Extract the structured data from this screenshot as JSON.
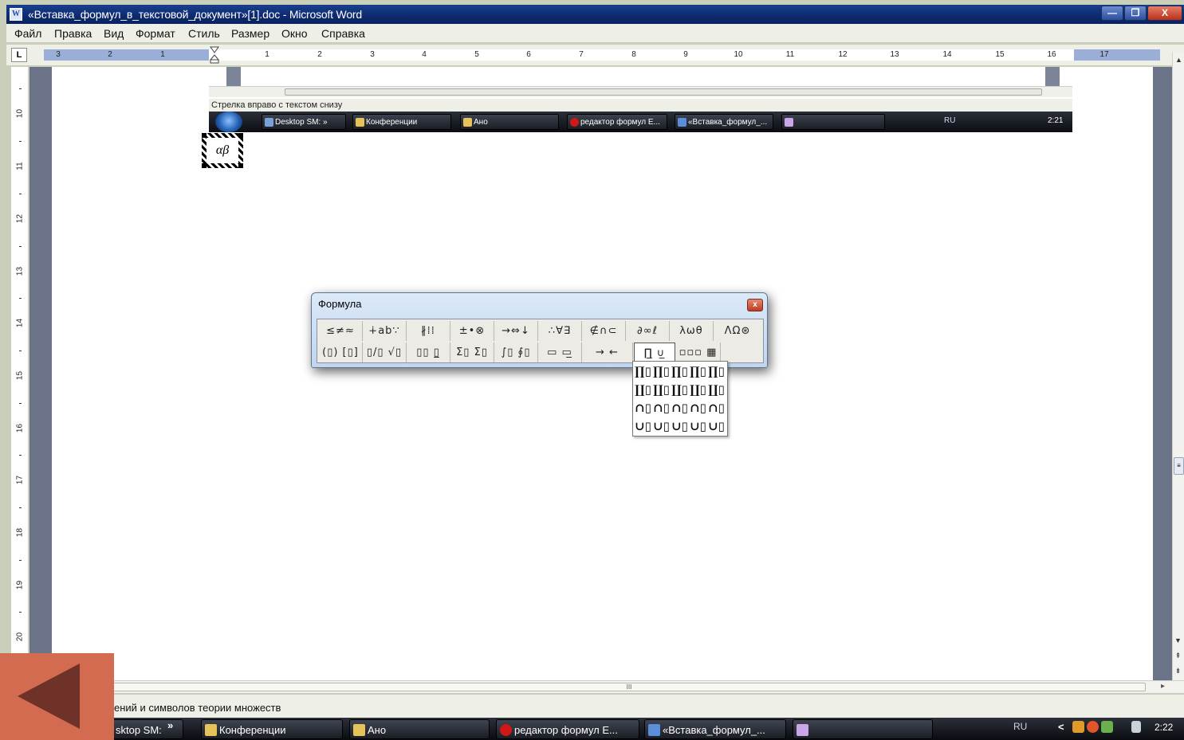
{
  "window": {
    "title": "«Вставка_формул_в_текстовой_документ»[1].doc - Microsoft Word",
    "app_icon": "W",
    "min_label": "—",
    "max_label": "❐",
    "close_label": "X"
  },
  "menu": [
    "Файл",
    "Правка",
    "Вид",
    "Формат",
    "Стиль",
    "Размер",
    "Окно",
    "Справка"
  ],
  "ruler": {
    "tab_selector": "L",
    "ticks": [
      "3",
      "2",
      "1",
      "1",
      "2",
      "3",
      "4",
      "5",
      "6",
      "7",
      "8",
      "9",
      "10",
      "11",
      "12",
      "13",
      "14",
      "15",
      "16",
      "17"
    ]
  },
  "vertical_ruler": [
    "10",
    "11",
    "12",
    "13",
    "14",
    "15",
    "16",
    "17",
    "18",
    "19",
    "20"
  ],
  "embedded": {
    "status_text": "Стрелка вправо с текстом снизу",
    "taskbar_items": [
      "Desktop SM: »",
      "Конференции",
      "Ано",
      "редактор формул E...",
      "«Вставка_формул_..."
    ],
    "tray_lang": "RU",
    "tray_time": "2:21"
  },
  "selected_object_text": "αβ",
  "formula_toolbar": {
    "title": "Формула",
    "close_label": "x",
    "row1": [
      "≤≠≈",
      "∔ab∵",
      "∦⁞⁞",
      "±•⊗",
      "→⇔↓",
      "∴∀∃",
      "∉∩⊂",
      "∂∞ℓ",
      "λωθ",
      "ΛΩ⊛"
    ],
    "row2": [
      "(▯) [▯]",
      "▯/▯ √▯",
      "▯▯ ▯̲",
      "Σ▯ Σ▯",
      "∫▯ ∮▯",
      "▭ ▭̲",
      "→ ←",
      "∏̲ ∪̲",
      "▫▫▫ ▦"
    ]
  },
  "palette": {
    "rows": [
      [
        "∏▯",
        "∏▯",
        "∏▯",
        "∏▯",
        "∏▯"
      ],
      [
        "∐▯",
        "∐▯",
        "∐▯",
        "∐▯",
        "∐▯"
      ],
      [
        "∩▯",
        "∩▯",
        "∩▯",
        "∩▯",
        "∩▯"
      ],
      [
        "∪▯",
        "∪▯",
        "∪▯",
        "∪▯",
        "∪▯"
      ]
    ]
  },
  "scroll": {
    "thumb_label": "III"
  },
  "statusbar": {
    "text": "ений и символов теории множеств"
  },
  "taskbar": {
    "items": [
      "sktop SM:",
      "Конференции",
      "Ано",
      "редактор формул E...",
      "«Вставка_формул_..."
    ],
    "quick_launch_arrow": "»",
    "tray_lang": "RU",
    "tray_time": "2:22"
  },
  "colors": {
    "titlebar": "#0c2a6e",
    "back_arrow_bg": "#d26b4f",
    "back_arrow_fg": "#6e3228"
  },
  "icons": [
    "word-icon",
    "minimize-icon",
    "maximize-icon",
    "close-icon",
    "windows-start-icon",
    "back-arrow-icon"
  ]
}
